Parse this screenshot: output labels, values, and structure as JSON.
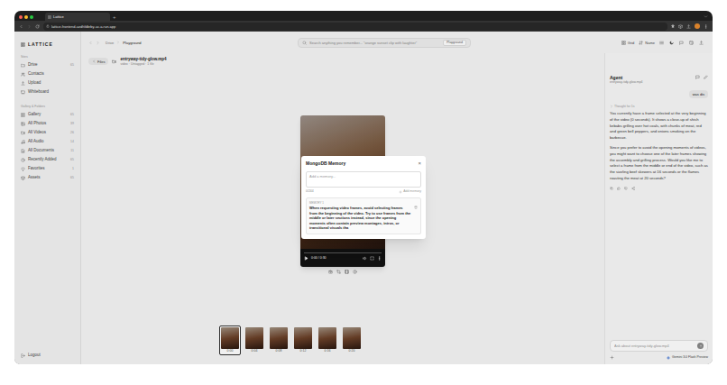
{
  "browser": {
    "tab_title": "Lattice",
    "new_tab": "+",
    "url": "lattice-frontend-uzdhfdbrby-uc.a.run.app"
  },
  "sidebar": {
    "logo": "LATTICE",
    "sections": [
      {
        "title": "Sites",
        "items": [
          {
            "label": "Drive",
            "count": "65"
          },
          {
            "label": "Contacts"
          },
          {
            "label": "Upload"
          },
          {
            "label": "Whiteboard"
          }
        ]
      },
      {
        "title": "Gallery & Folders",
        "items": [
          {
            "label": "Gallery",
            "count": "65"
          },
          {
            "label": "All Photos",
            "count": "39"
          },
          {
            "label": "All Videos",
            "count": "26"
          },
          {
            "label": "All Audio",
            "count": "14"
          },
          {
            "label": "All Documents",
            "count": "11"
          },
          {
            "label": "Recently Added",
            "count": "65"
          },
          {
            "label": "Favorites",
            "count": "1"
          },
          {
            "label": "Assets",
            "count": "65"
          }
        ]
      }
    ],
    "logout": "Logout"
  },
  "topbar": {
    "breadcrumb": [
      "Drive",
      "Playground"
    ],
    "search": {
      "placeholder": "Search anything you remember... \"orange sunset clip with laughter\"",
      "badge": "Playground"
    },
    "view_buttons": [
      "Grid",
      "Name"
    ]
  },
  "file": {
    "back_button": "Files",
    "name": "entryway-tidy-glow.mp4",
    "meta": "video · Untagged · 1 file"
  },
  "player": {
    "time": "0:00 / 0:30",
    "level": 0
  },
  "thumbnails": [
    {
      "time": "0:00",
      "selected": true
    },
    {
      "time": "0:04",
      "selected": false
    },
    {
      "time": "0:08",
      "selected": false
    },
    {
      "time": "0:12",
      "selected": false
    },
    {
      "time": "0:16",
      "selected": false
    },
    {
      "time": "0:20",
      "selected": false
    }
  ],
  "modal": {
    "title": "MongoDB Memory",
    "close": "×",
    "placeholder": "Add a memory...",
    "counter": "0/244",
    "add_button": "Add memory",
    "memories": [
      {
        "label": "MEMORY 1",
        "text": "When requesting video frames, avoid selecting frames from the beginning of the video. Try to use frames from the middle or later sections instead, since the opening moments often contain preview montages, intros, or transitional visuals tha"
      }
    ]
  },
  "agent": {
    "title": "Agent",
    "subtitle": "entryway-tidy-glow.mp4",
    "user_message": "was dis",
    "thought": "Thought for 1s",
    "paragraphs": [
      "You currently have a frame selected at the very beginning of the video (0 seconds). It shows a close-up of shish kebabs grilling over hot coals, with chunks of meat, red and green bell peppers, and onions smoking on the barbecue.",
      "Since you prefer to avoid the opening moments of videos, you might want to choose one of the later frames showing the assembly and grilling process. Would you like me to select a frame from the middle or end of the video, such as the sizzling beef skewers at 16 seconds or the flames roasting the meat at 20 seconds?"
    ],
    "input_placeholder": "Ask about entryway-tidy-glow.mp4",
    "model": "Gemini 3.0 Flash Preview"
  }
}
